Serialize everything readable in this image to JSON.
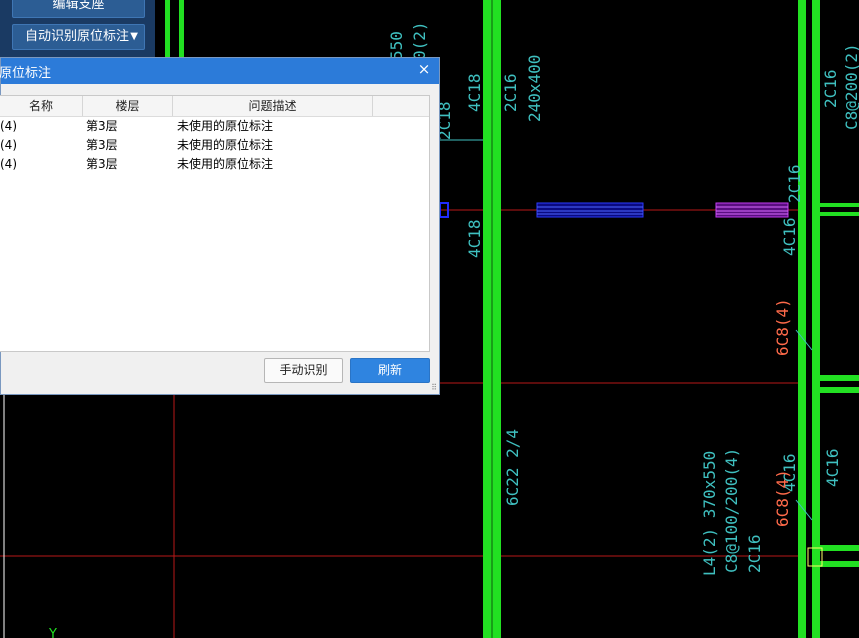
{
  "toolbar": {
    "edit_support_label": "编辑支座",
    "auto_identify_label": "自动识别原位标注",
    "dropdown_icon": "chevron-down-icon"
  },
  "dialog": {
    "title": "原位标注",
    "close_glyph": "×",
    "columns": [
      "名称",
      "楼层",
      "问题描述"
    ],
    "rows": [
      {
        "name": "(4)",
        "floor": "第3层",
        "desc": "未使用的原位标注"
      },
      {
        "name": "(4)",
        "floor": "第3层",
        "desc": "未使用的原位标注"
      },
      {
        "name": "(4)",
        "floor": "第3层",
        "desc": "未使用的原位标注"
      }
    ],
    "manual_button": "手动识别",
    "refresh_button": "刷新"
  },
  "cad_annotations": {
    "beam_top_a": "550",
    "beam_top_b": "0(2)",
    "col_a": "4C18",
    "col_b": "2C16",
    "col_c": "240x400",
    "partial_left": "2C18",
    "col_d": "4C18",
    "right_a": "2C16",
    "right_b": "C8@200(2)",
    "right_c": "2C16",
    "right_d": "4C16",
    "red_a": "6C8(4)",
    "mid_a": "6C22 2/4",
    "lower_a": "L4(2) 370x550",
    "lower_b": "C8@100/200(4)",
    "lower_c": "2C16",
    "lower_red": "6C8(4)",
    "lower_d": "4C16",
    "lower_e": "4C16",
    "axis_label": "Y"
  },
  "colors": {
    "background": "#000000",
    "wall_green": "#22e022",
    "annotation_cyan": "#3fc0c0",
    "annotation_red": "#ff6a4a",
    "grid_red": "#b81818",
    "rebar_blue": "#1f2cff",
    "rebar_magenta": "#b22fe8",
    "dialog_title": "#2c7bd9"
  }
}
